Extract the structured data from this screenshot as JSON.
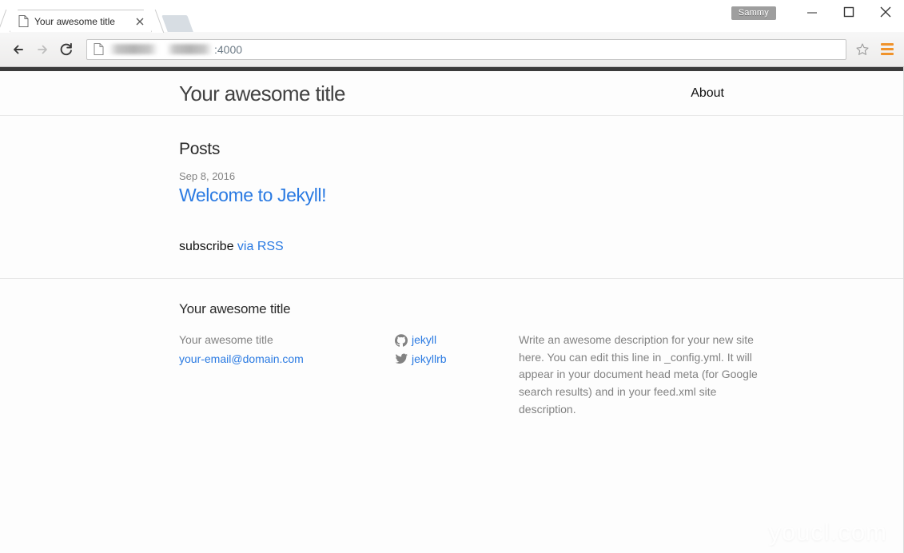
{
  "browser": {
    "tab": {
      "title": "Your awesome title",
      "favicon": "page-icon",
      "close": "×"
    },
    "new_tab_label": "",
    "profile_chip": "Sammy",
    "window_controls": {
      "minimize": "minimize-icon",
      "maximize": "maximize-icon",
      "close": "close-icon"
    },
    "toolbar": {
      "back": "back-arrow-icon",
      "forward": "forward-arrow-icon",
      "reload": "reload-icon",
      "page_icon": "page-icon",
      "url_host_redacted": "",
      "url_port": ":4000",
      "bookmark": "star-icon",
      "menu": "hamburger-menu-icon"
    }
  },
  "site": {
    "header": {
      "title": "Your awesome title",
      "nav": [
        {
          "label": "About"
        }
      ]
    },
    "content": {
      "posts_heading": "Posts",
      "posts": [
        {
          "date": "Sep 8, 2016",
          "title": "Welcome to Jekyll!"
        }
      ],
      "subscribe_text": "subscribe ",
      "subscribe_link": "via RSS"
    },
    "footer": {
      "heading": "Your awesome title",
      "contact": [
        {
          "text": "Your awesome title",
          "link": false
        },
        {
          "text": "your-email@domain.com",
          "link": true
        }
      ],
      "social": [
        {
          "icon": "github-icon",
          "label": "jekyll"
        },
        {
          "icon": "twitter-icon",
          "label": "jekyllrb"
        }
      ],
      "description": "Write an awesome description for your new site here. You can edit this line in _config.yml. It will appear in your document head meta (for Google search results) and in your feed.xml site description."
    }
  },
  "watermark": "youcl.com",
  "colors": {
    "link_blue": "#2a7ae2",
    "muted_gray": "#828282",
    "site_topbar": "#3b3b3b",
    "menu_orange": "#f0932b"
  }
}
